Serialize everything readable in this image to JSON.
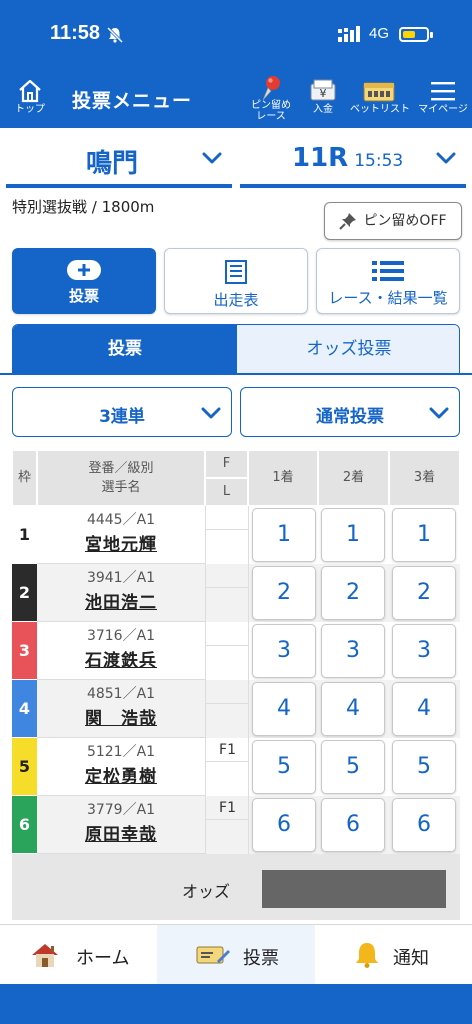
{
  "status_bar": {
    "time": "11:58",
    "network": "4G",
    "colors": {
      "bar": "#1565c9",
      "battery": "#ffd400"
    }
  },
  "app_bar": {
    "title": "投票メニュー",
    "top_label": "トップ",
    "pin_label_1": "ピン留め",
    "pin_label_2": "レース",
    "deposit_label": "入金",
    "betlist_label": "ベットリスト",
    "mypage_label": "マイページ"
  },
  "selector": {
    "venue": "鳴門",
    "race": "11R",
    "race_time": "15:53"
  },
  "race_info": {
    "title": "特別選抜戦",
    "distance": "1800m",
    "separator": " / "
  },
  "pin_off_label": "ピン留めOFF",
  "tiles": [
    {
      "label": "投票",
      "icon": "plus-icon"
    },
    {
      "label": "出走表",
      "icon": "racecard-icon"
    },
    {
      "label": "レース・結果一覧",
      "icon": "list-icon"
    }
  ],
  "bet_tabs": {
    "active": "投票",
    "inactive": "オッズ投票"
  },
  "dropdowns": {
    "bet_type": "3連単",
    "bet_method": "通常投票"
  },
  "table": {
    "headers": {
      "frame": "枠",
      "racer_line1": "登番／級別",
      "racer_line2": "選手名",
      "f": "F",
      "l": "L",
      "first": "1着",
      "second": "2着",
      "third": "3着"
    },
    "rows": [
      {
        "frame": "1",
        "reg": "4445／A1",
        "name": "宮地元輝",
        "f": "",
        "l": "",
        "color": "#ffffff",
        "text_color": "#222222"
      },
      {
        "frame": "2",
        "reg": "3941／A1",
        "name": "池田浩二",
        "f": "",
        "l": "",
        "color": "#2b2b2b",
        "text_color": "#ffffff"
      },
      {
        "frame": "3",
        "reg": "3716／A1",
        "name": "石渡鉄兵",
        "f": "",
        "l": "",
        "color": "#e8535a",
        "text_color": "#ffffff"
      },
      {
        "frame": "4",
        "reg": "4851／A1",
        "name": "関　浩哉",
        "f": "",
        "l": "",
        "color": "#3f86e0",
        "text_color": "#ffffff"
      },
      {
        "frame": "5",
        "reg": "5121／A1",
        "name": "定松勇樹",
        "f": "F1",
        "l": "",
        "color": "#f6dd2a",
        "text_color": "#222222"
      },
      {
        "frame": "6",
        "reg": "3779／A1",
        "name": "原田幸哉",
        "f": "F1",
        "l": "",
        "color": "#2aa35b",
        "text_color": "#ffffff"
      }
    ],
    "odds_label": "オッズ"
  },
  "bottom_nav": {
    "home": "ホーム",
    "bet": "投票",
    "notify": "通知"
  }
}
